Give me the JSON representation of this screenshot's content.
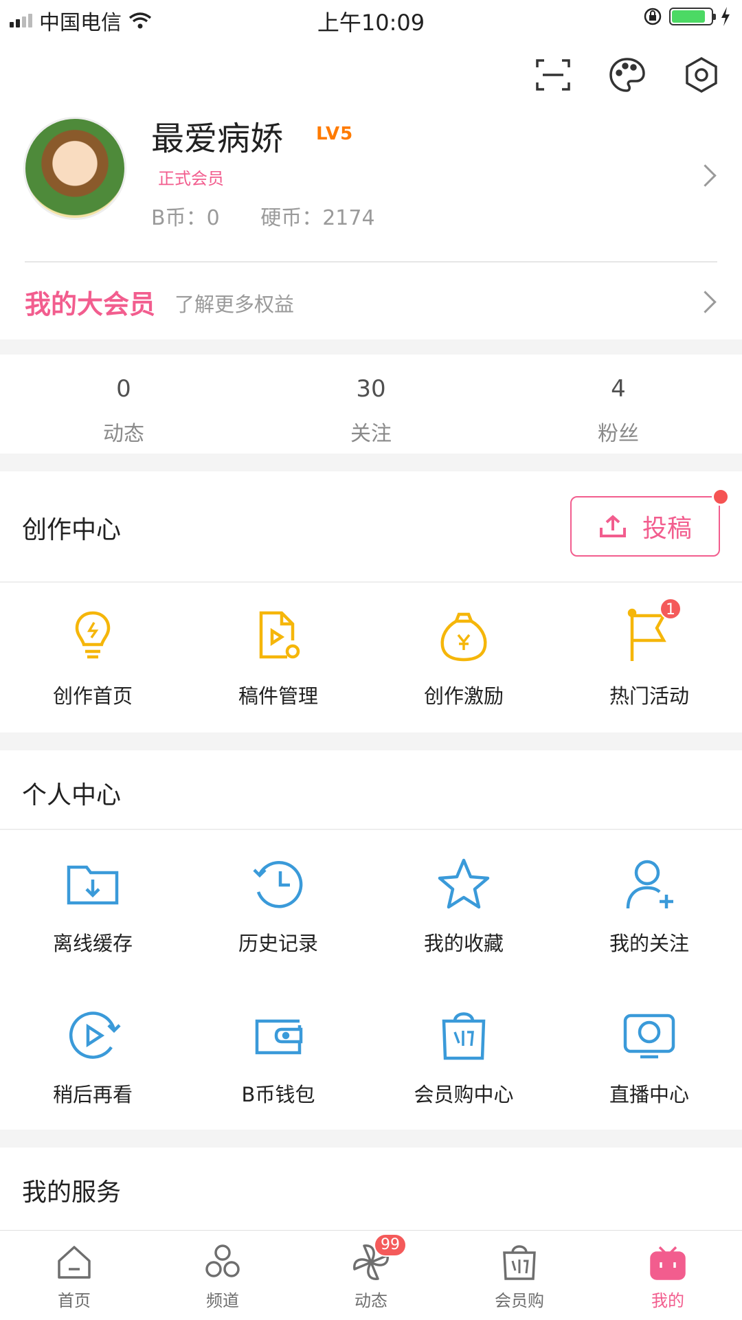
{
  "status_bar": {
    "carrier": "中国电信",
    "time": "上午10:09"
  },
  "profile": {
    "username": "最爱病娇",
    "level": "LV5",
    "member_type": "正式会员",
    "bcoin": "B币：0",
    "hardcoin": "硬币：2174"
  },
  "big_vip": {
    "title": "我的大会员",
    "subtitle": "了解更多权益"
  },
  "stats": [
    {
      "value": "0",
      "label": "动态"
    },
    {
      "value": "30",
      "label": "关注"
    },
    {
      "value": "4",
      "label": "粉丝"
    }
  ],
  "creation_center": {
    "title": "创作中心",
    "upload_label": "投稿",
    "items": [
      {
        "label": "创作首页",
        "icon": "lightbulb-icon"
      },
      {
        "label": "稿件管理",
        "icon": "video-file-icon"
      },
      {
        "label": "创作激励",
        "icon": "money-bag-icon"
      },
      {
        "label": "热门活动",
        "icon": "flag-icon",
        "badge": "1"
      }
    ]
  },
  "personal_center": {
    "title": "个人中心",
    "items": [
      {
        "label": "离线缓存",
        "icon": "download-folder-icon"
      },
      {
        "label": "历史记录",
        "icon": "history-clock-icon"
      },
      {
        "label": "我的收藏",
        "icon": "star-icon"
      },
      {
        "label": "我的关注",
        "icon": "add-user-icon"
      },
      {
        "label": "稍后再看",
        "icon": "play-later-icon"
      },
      {
        "label": "B币钱包",
        "icon": "wallet-icon"
      },
      {
        "label": "会员购中心",
        "icon": "shopping-bag-icon"
      },
      {
        "label": "直播中心",
        "icon": "live-tv-icon"
      }
    ]
  },
  "my_services": {
    "title": "我的服务"
  },
  "tab_bar": {
    "items": [
      {
        "label": "首页",
        "icon": "home-icon"
      },
      {
        "label": "频道",
        "icon": "channel-icon"
      },
      {
        "label": "动态",
        "icon": "pinwheel-icon",
        "badge": "99"
      },
      {
        "label": "会员购",
        "icon": "shop-bag-icon"
      },
      {
        "label": "我的",
        "icon": "bilibili-tv-icon"
      }
    ],
    "active_index": 4
  },
  "colors": {
    "pink": "#f25d8e",
    "yellow": "#f5b60a",
    "blue": "#3a9ad9",
    "level": "#ff7b00"
  }
}
